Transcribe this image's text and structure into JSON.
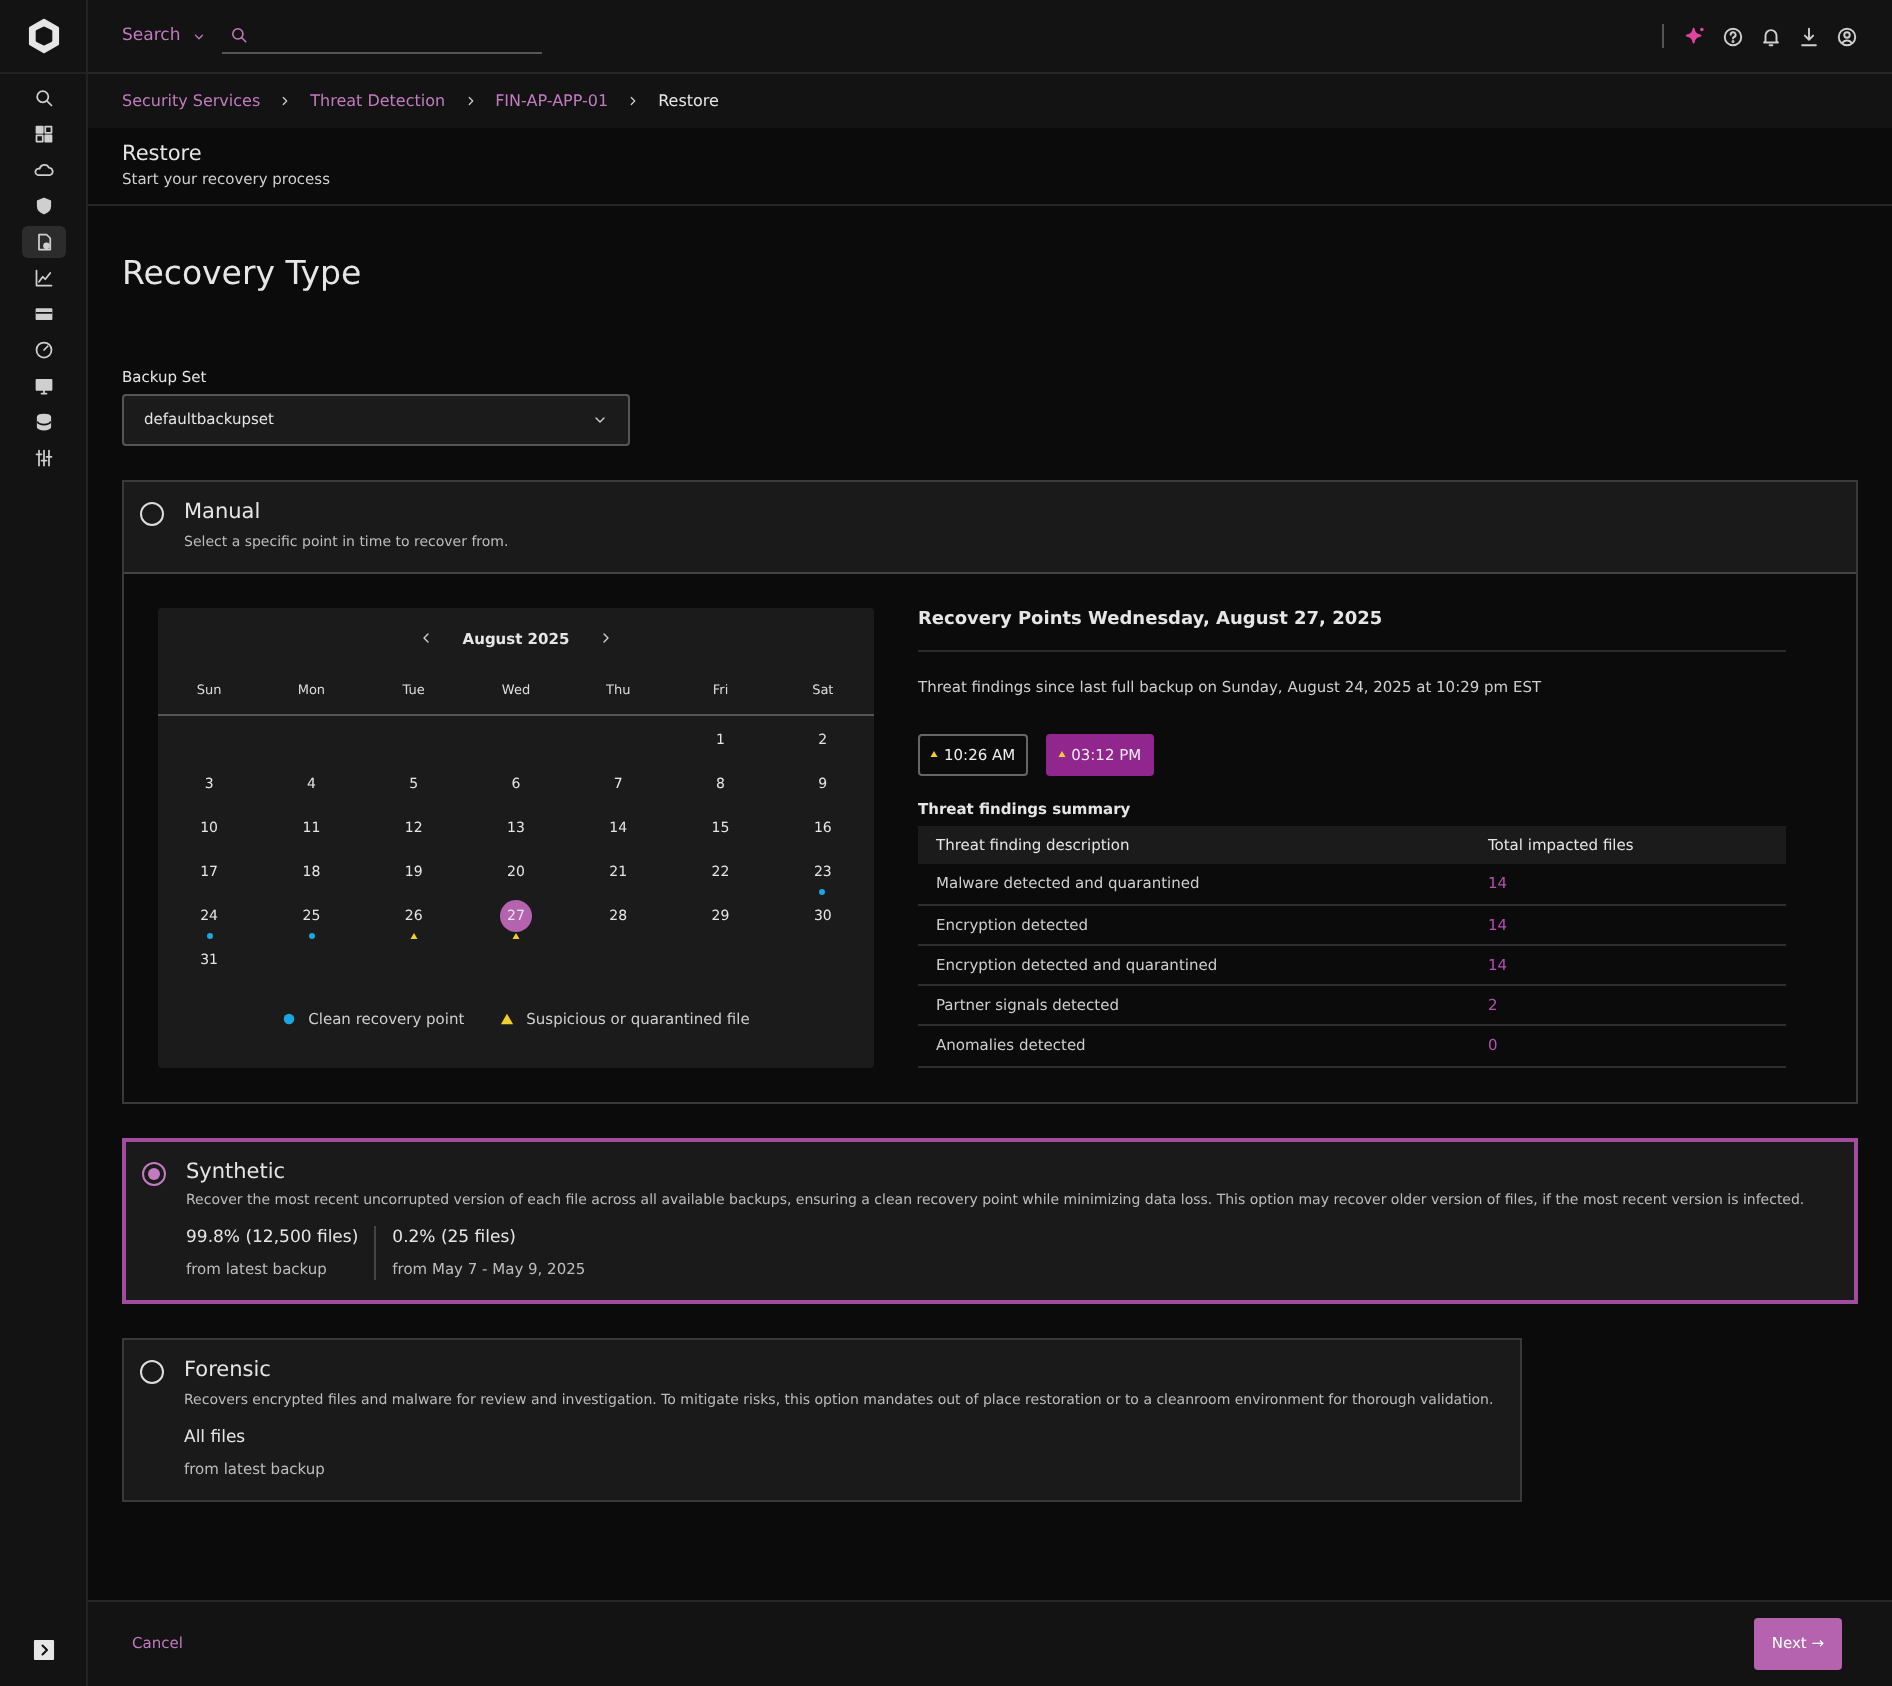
{
  "sidebar": {
    "items": [
      {
        "selected": false
      },
      {
        "selected": false
      },
      {
        "selected": false
      },
      {
        "selected": false
      },
      {
        "selected": true
      },
      {
        "selected": false
      },
      {
        "selected": false
      },
      {
        "selected": false
      },
      {
        "selected": false
      },
      {
        "selected": false
      },
      {
        "selected": false
      }
    ]
  },
  "top_bar": {
    "search_scope": "Search"
  },
  "breadcrumbs": [
    {
      "label": "Security Services",
      "current": false
    },
    {
      "label": "Threat Detection",
      "current": false
    },
    {
      "label": "FIN-AP-APP-01",
      "current": false
    },
    {
      "label": "Restore",
      "current": true
    }
  ],
  "page_header": {
    "title": "Restore",
    "subtitle": "Start your recovery process"
  },
  "heading": "Recovery Type",
  "backup_set": {
    "label": "Backup Set",
    "value": "defaultbackupset"
  },
  "options": [
    {
      "kind": "manual",
      "title": "Manual",
      "description": "Select a specific point in time to recover from.",
      "selected": false,
      "calendar": {
        "month": "August 2025",
        "weekdays": [
          "Sun",
          "Mon",
          "Tue",
          "Wed",
          "Thu",
          "Fri",
          "Sat"
        ],
        "weeks": [
          [
            {
              "kind": "blank"
            },
            {
              "kind": "blank"
            },
            {
              "kind": "blank"
            },
            {
              "kind": "blank"
            },
            {
              "kind": "blank"
            },
            {
              "kind": "day",
              "day": "1",
              "selected": false,
              "clean": false,
              "suspicious": false
            },
            {
              "kind": "day",
              "day": "2",
              "selected": false,
              "clean": false,
              "suspicious": false
            }
          ],
          [
            {
              "kind": "day",
              "day": "3",
              "selected": false,
              "clean": false,
              "suspicious": false
            },
            {
              "kind": "day",
              "day": "4",
              "selected": false,
              "clean": false,
              "suspicious": false
            },
            {
              "kind": "day",
              "day": "5",
              "selected": false,
              "clean": false,
              "suspicious": false
            },
            {
              "kind": "day",
              "day": "6",
              "selected": false,
              "clean": false,
              "suspicious": false
            },
            {
              "kind": "day",
              "day": "7",
              "selected": false,
              "clean": false,
              "suspicious": false
            },
            {
              "kind": "day",
              "day": "8",
              "selected": false,
              "clean": false,
              "suspicious": false
            },
            {
              "kind": "day",
              "day": "9",
              "selected": false,
              "clean": false,
              "suspicious": false
            }
          ],
          [
            {
              "kind": "day",
              "day": "10",
              "selected": false,
              "clean": false,
              "suspicious": false
            },
            {
              "kind": "day",
              "day": "11",
              "selected": false,
              "clean": false,
              "suspicious": false
            },
            {
              "kind": "day",
              "day": "12",
              "selected": false,
              "clean": false,
              "suspicious": false
            },
            {
              "kind": "day",
              "day": "13",
              "selected": false,
              "clean": false,
              "suspicious": false
            },
            {
              "kind": "day",
              "day": "14",
              "selected": false,
              "clean": false,
              "suspicious": false
            },
            {
              "kind": "day",
              "day": "15",
              "selected": false,
              "clean": false,
              "suspicious": false
            },
            {
              "kind": "day",
              "day": "16",
              "selected": false,
              "clean": false,
              "suspicious": false
            }
          ],
          [
            {
              "kind": "day",
              "day": "17",
              "selected": false,
              "clean": false,
              "suspicious": false
            },
            {
              "kind": "day",
              "day": "18",
              "selected": false,
              "clean": false,
              "suspicious": false
            },
            {
              "kind": "day",
              "day": "19",
              "selected": false,
              "clean": false,
              "suspicious": false
            },
            {
              "kind": "day",
              "day": "20",
              "selected": false,
              "clean": false,
              "suspicious": false
            },
            {
              "kind": "day",
              "day": "21",
              "selected": false,
              "clean": false,
              "suspicious": false
            },
            {
              "kind": "day",
              "day": "22",
              "selected": false,
              "clean": false,
              "suspicious": false
            },
            {
              "kind": "day",
              "day": "23",
              "selected": false,
              "clean": true,
              "suspicious": false
            }
          ],
          [
            {
              "kind": "day",
              "day": "24",
              "selected": false,
              "clean": true,
              "suspicious": false
            },
            {
              "kind": "day",
              "day": "25",
              "selected": false,
              "clean": true,
              "suspicious": false
            },
            {
              "kind": "day",
              "day": "26",
              "selected": false,
              "clean": false,
              "suspicious": true
            },
            {
              "kind": "day",
              "day": "27",
              "selected": true,
              "clean": false,
              "suspicious": true
            },
            {
              "kind": "day",
              "day": "28",
              "selected": false,
              "clean": false,
              "suspicious": false
            },
            {
              "kind": "day",
              "day": "29",
              "selected": false,
              "clean": false,
              "suspicious": false
            },
            {
              "kind": "day",
              "day": "30",
              "selected": false,
              "clean": false,
              "suspicious": false
            }
          ],
          [
            {
              "kind": "day",
              "day": "31",
              "selected": false,
              "clean": false,
              "suspicious": false
            },
            {
              "kind": "blank"
            },
            {
              "kind": "blank"
            },
            {
              "kind": "blank"
            },
            {
              "kind": "blank"
            },
            {
              "kind": "blank"
            },
            {
              "kind": "blank"
            }
          ]
        ],
        "legend": [
          {
            "kind": "clean",
            "label": "Clean recovery point"
          },
          {
            "kind": "suspicious",
            "label": "Suspicious or quarantined file"
          }
        ]
      },
      "recovery_points": {
        "title": "Recovery Points Wednesday, August 27, 2025",
        "subtitle": "Threat findings since last full backup on Sunday, August 24, 2025 at 10:29 pm EST",
        "times": [
          {
            "label": "10:26 AM",
            "selected": false,
            "suspicious": true
          },
          {
            "label": "03:12 PM",
            "selected": true,
            "suspicious": true
          }
        ],
        "summary_title": "Threat findings summary",
        "columns": [
          "Threat finding description",
          "Total impacted files"
        ],
        "rows": [
          [
            "Malware detected and quarantined",
            "14"
          ],
          [
            "Encryption detected",
            "14"
          ],
          [
            "Encryption detected and quarantined",
            "14"
          ],
          [
            "Partner signals detected",
            "2"
          ],
          [
            "Anomalies detected",
            "0"
          ]
        ]
      }
    },
    {
      "kind": "synthetic",
      "title": "Synthetic",
      "description": "Recover the most recent uncorrupted version of each file across all available backups, ensuring a clean recovery point while minimizing data loss.  This option may recover older version of files, if the most recent version is infected.",
      "selected": true,
      "stats": [
        {
          "value": "99.8% (12,500 files)",
          "caption": "from latest backup"
        },
        {
          "value": "0.2% (25 files)",
          "caption": "from May 7 - May 9, 2025"
        }
      ]
    },
    {
      "kind": "forensic",
      "title": "Forensic",
      "description": "Recovers encrypted files and malware for review and investigation. To mitigate risks, this option mandates out of place restoration or to a cleanroom environment for thorough validation.",
      "selected": false,
      "stats": [
        {
          "value": "All files",
          "caption": "from latest backup"
        }
      ]
    }
  ],
  "footer": {
    "cancel": "Cancel",
    "next": "Next →"
  }
}
